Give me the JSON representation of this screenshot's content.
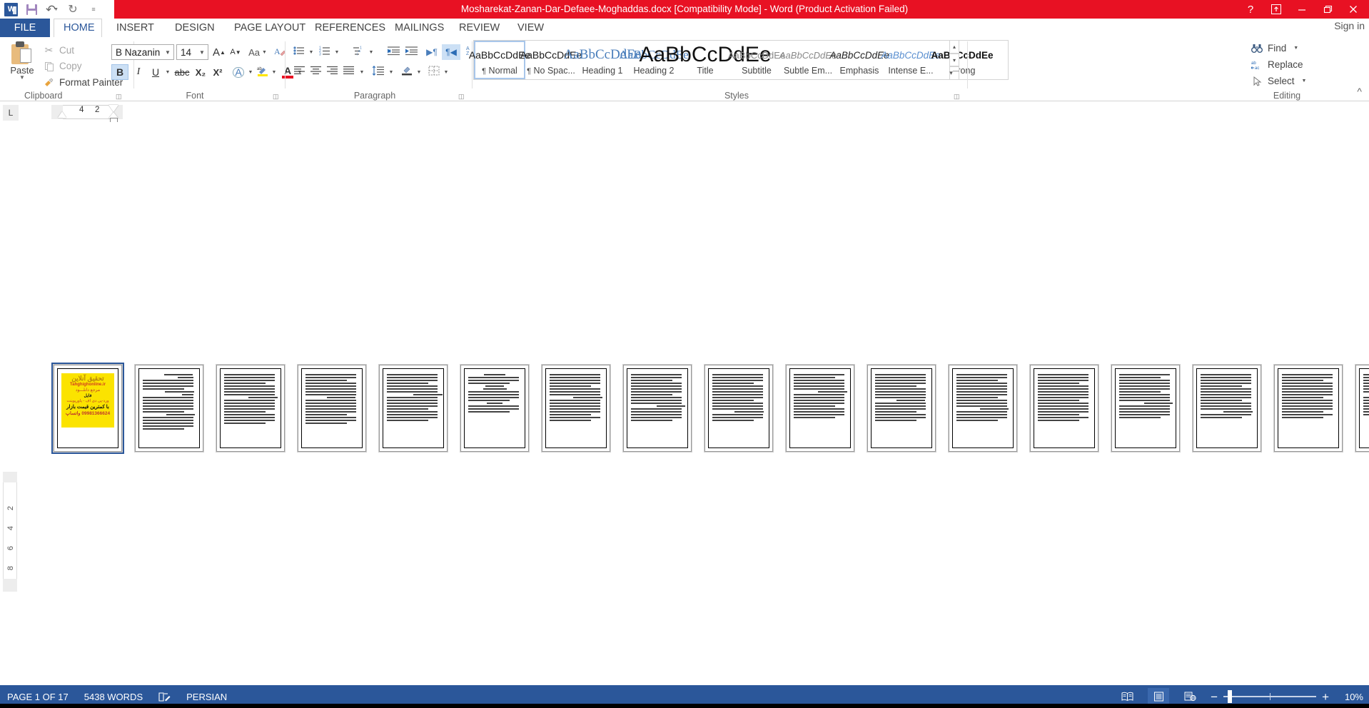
{
  "window": {
    "title": "Mosharekat-Zanan-Dar-Defaee-Moghaddas.docx [Compatibility Mode]  -  Word (Product Activation Failed)",
    "help_icon": "?",
    "ribbon_display_icon": "ribbon-display-options-icon",
    "minimize_icon": "minimize-icon",
    "restore_icon": "restore-icon",
    "close_icon": "close-icon",
    "sign_in": "Sign in",
    "app_icon": "word-logo-icon"
  },
  "quick_access": {
    "save_icon": "save-icon",
    "undo_icon": "undo-icon",
    "redo_icon": "redo-icon",
    "customize_icon": "customize-qat-icon"
  },
  "tabs": [
    {
      "label": "FILE",
      "id": "file"
    },
    {
      "label": "HOME",
      "id": "home"
    },
    {
      "label": "INSERT",
      "id": "insert"
    },
    {
      "label": "DESIGN",
      "id": "design"
    },
    {
      "label": "PAGE LAYOUT",
      "id": "page-layout"
    },
    {
      "label": "REFERENCES",
      "id": "references"
    },
    {
      "label": "MAILINGS",
      "id": "mailings"
    },
    {
      "label": "REVIEW",
      "id": "review"
    },
    {
      "label": "VIEW",
      "id": "view"
    }
  ],
  "clipboard": {
    "label": "Clipboard",
    "paste": "Paste",
    "cut": "Cut",
    "copy": "Copy",
    "format_painter": "Format Painter",
    "dialog_launcher": "dialog-box-launcher"
  },
  "font": {
    "label": "Font",
    "family": "B Nazanin",
    "size": "14",
    "grow_font": "A",
    "shrink_font": "A",
    "change_case": "Aa",
    "clear_formatting": "clear-formatting-icon",
    "bold": "B",
    "italic": "I",
    "underline": "U",
    "strikethrough": "abc",
    "subscript": "X₂",
    "superscript": "X²",
    "text_effects": "A",
    "highlight": "ab",
    "font_color": "A",
    "bold_active": true
  },
  "paragraph": {
    "label": "Paragraph",
    "bullets": "bullets-icon",
    "numbering": "numbering-icon",
    "multilevel": "multilevel-list-icon",
    "decrease_indent": "decrease-indent-icon",
    "increase_indent": "increase-indent-icon",
    "ltr_text": "ltr-text-direction-icon",
    "rtl_text": "rtl-text-direction-icon",
    "sort": "sort-icon",
    "show_marks": "show-paragraph-marks-icon",
    "align_left": "align-left-icon",
    "align_center": "align-center-icon",
    "align_right": "align-right-icon",
    "justify": "justify-icon",
    "line_spacing": "line-spacing-icon",
    "shading": "shading-icon",
    "borders": "borders-icon",
    "rtl_active": true
  },
  "styles": {
    "label": "Styles",
    "items": [
      {
        "preview": "AaBbCcDdEe",
        "name": "Normal",
        "mark": "¶",
        "selected": true
      },
      {
        "preview": "AaBbCcDdEe",
        "name": "No Spac...",
        "mark": "¶",
        "selected": false
      },
      {
        "preview": "AaBbCcDdEe",
        "name": "Heading 1",
        "mark": "",
        "selected": false
      },
      {
        "preview": "AaBbCcDdEe",
        "name": "Heading 2",
        "mark": "",
        "selected": false
      },
      {
        "preview": "AaBbCcDdEe",
        "name": "Title",
        "mark": "",
        "selected": false
      },
      {
        "preview": "AaBbCcDdEe",
        "name": "Subtitle",
        "mark": "",
        "selected": false
      },
      {
        "preview": "AaBbCcDdEe",
        "name": "Subtle Em...",
        "mark": "",
        "selected": false
      },
      {
        "preview": "AaBbCcDdEe",
        "name": "Emphasis",
        "mark": "",
        "selected": false
      },
      {
        "preview": "AaBbCcDdEe",
        "name": "Intense E...",
        "mark": "",
        "selected": false
      },
      {
        "preview": "AaBbCcDdEe",
        "name": "Strong",
        "mark": "",
        "selected": false
      }
    ],
    "scroll_up": "▴",
    "scroll_down": "▾",
    "more": "≡",
    "dialog_launcher": "dialog-box-launcher"
  },
  "editing": {
    "label": "Editing",
    "find": "Find",
    "replace": "Replace",
    "select": "Select",
    "find_icon": "binoculars-icon",
    "replace_icon": "replace-icon",
    "select_icon": "cursor-arrow-icon",
    "collapse_ribbon": "collapse-ribbon-icon"
  },
  "ruler": {
    "tab_stop": "L",
    "h_numbers": [
      "4",
      "2"
    ],
    "v_numbers": [
      "2",
      "4",
      "6",
      "8"
    ]
  },
  "document": {
    "page_count": 17,
    "banner": {
      "title": "تحقیق آنلاین",
      "site": "Tahghighonline.ir",
      "line1": "مرجع دانلـــود",
      "line2": "فایل",
      "line3": "ورد-پی دی اف - پاورپوینت",
      "line4": "با کمترین قیمت بازار",
      "line5": "09981366624 واتساپ"
    }
  },
  "status": {
    "page_info": "PAGE 1 OF 17",
    "word_count": "5438 WORDS",
    "proofing_icon": "proofing-errors-icon",
    "language": "PERSIAN",
    "read_mode_icon": "read-mode-icon",
    "print_layout_icon": "print-layout-icon",
    "web_layout_icon": "web-layout-icon",
    "zoom_out": "−",
    "zoom_in": "+",
    "zoom_level": "10%"
  },
  "colors": {
    "titlebar_red": "#e81123",
    "word_blue": "#2b579a",
    "status_blue": "#2b579a",
    "selection_blue": "#cce0f5",
    "banner_yellow": "#fbe300"
  }
}
